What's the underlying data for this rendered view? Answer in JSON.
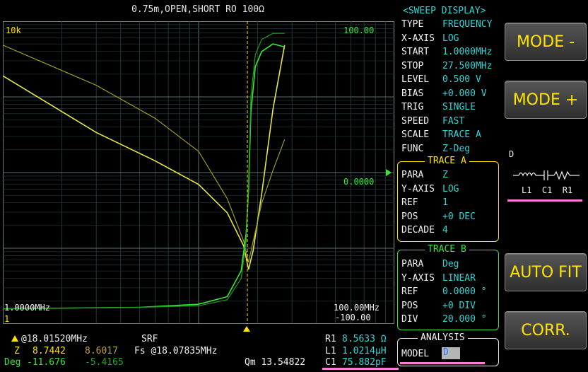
{
  "header": {
    "title": "0.75m,OPEN,SHORT  RO 100Ω"
  },
  "plot": {
    "y_top_left": "10k",
    "y_top_right": "100.00",
    "y_mid_right": "0.0000",
    "y_bottom_right": "-100.00",
    "x_left": "1.0000MHz",
    "x_right": "100.00MHz",
    "marker_id": "1"
  },
  "chart_data": {
    "type": "line",
    "xlabel": "",
    "ylabel": "",
    "x_scale": "log",
    "x_range_MHz": [
      1.0,
      100.0
    ],
    "yA_scale": "log",
    "yB_range_deg": [
      -100,
      100
    ],
    "grid": true,
    "marker_MHz": 18.0152,
    "series": [
      {
        "color": "#e6e64a",
        "axis": "A",
        "x_MHz": [
          1.0,
          3.0,
          6.0,
          10.0,
          14.0,
          17.0,
          18.0,
          19.0,
          21.0,
          24.0,
          27.5
        ],
        "z_rel": [
          0.82,
          0.58,
          0.46,
          0.36,
          0.24,
          0.1,
          0.0,
          0.08,
          0.32,
          0.68,
          0.95
        ]
      },
      {
        "color": "#9a9a2a",
        "axis": "A",
        "x_MHz": [
          1.0,
          3.0,
          6.0,
          10.0,
          14.0,
          17.0,
          18.0,
          19.0,
          21.0,
          24.0,
          27.5
        ],
        "z_rel": [
          0.95,
          0.78,
          0.64,
          0.5,
          0.3,
          0.12,
          0.03,
          0.12,
          0.28,
          0.42,
          0.55
        ]
      },
      {
        "color": "#39e639",
        "axis": "B",
        "x_MHz": [
          1.0,
          5.0,
          10.0,
          14.0,
          16.5,
          17.5,
          18.0,
          18.5,
          19.5,
          21.0,
          24.0,
          27.5
        ],
        "deg": [
          -90,
          -89,
          -87,
          -82,
          -65,
          -40,
          -11.7,
          40,
          70,
          80,
          85,
          83
        ]
      },
      {
        "color": "#1f9a1f",
        "axis": "B",
        "x_MHz": [
          1.0,
          5.0,
          10.0,
          14.0,
          16.5,
          17.5,
          18.0,
          18.5,
          19.5,
          21.0,
          24.0,
          27.5
        ],
        "deg": [
          -90,
          -89,
          -88,
          -84,
          -70,
          -45,
          -5.4,
          50,
          78,
          88,
          92,
          92
        ]
      }
    ]
  },
  "sweep": {
    "title": "<SWEEP DISPLAY>",
    "rows": [
      {
        "k": "TYPE",
        "v": "FREQUENCY"
      },
      {
        "k": "X-AXIS",
        "v": "LOG"
      },
      {
        "k": "START",
        "v": "1.0000MHz"
      },
      {
        "k": "STOP",
        "v": "27.500MHz"
      },
      {
        "k": "LEVEL",
        "v": "0.500 V"
      },
      {
        "k": "BIAS",
        "v": "+0.000 V"
      },
      {
        "k": "TRIG",
        "v": "SINGLE"
      },
      {
        "k": "SPEED",
        "v": "FAST"
      },
      {
        "k": "SCALE",
        "v": "TRACE A"
      },
      {
        "k": "FUNC",
        "v": "Z-Deg"
      }
    ]
  },
  "traceA": {
    "title": "TRACE A",
    "rows": [
      {
        "k": "PARA",
        "v": "Z"
      },
      {
        "k": "Y-AXIS",
        "v": "LOG"
      },
      {
        "k": "REF",
        "v": "1"
      },
      {
        "k": "POS",
        "v": "+0 DEC"
      },
      {
        "k": "DECADE",
        "v": "4"
      }
    ]
  },
  "traceB": {
    "title": "TRACE B",
    "rows": [
      {
        "k": "PARA",
        "v": "Deg"
      },
      {
        "k": "Y-AXIS",
        "v": "LINEAR"
      },
      {
        "k": "REF",
        "v": "0.0000 °"
      },
      {
        "k": "POS",
        "v": "+0 DIV"
      },
      {
        "k": "DIV",
        "v": "20.000 °"
      }
    ]
  },
  "analysis": {
    "title": "ANALYSIS",
    "model_label": "MODEL",
    "model_value": "D"
  },
  "buttons": {
    "mode_minus": "MODE -",
    "mode_plus": "MODE +",
    "auto_fit": "AUTO FIT",
    "corr": "CORR."
  },
  "model_diagram": {
    "title": "D",
    "labels": "L1  C1  R1"
  },
  "readout": {
    "marker_freq": "@18.01520MHz",
    "srf_label": "SRF",
    "fs_text": "Fs @18.07835MHz",
    "z_label": "Z",
    "z_a": "8.7442",
    "z_b": "8.6017",
    "deg_label": "Deg",
    "deg_a": "-11.676",
    "deg_b": "-5.4165",
    "qm_text": "Qm 13.54822",
    "r1_label": "R1",
    "r1_value": "8.5633 Ω",
    "l1_label": "L1",
    "l1_value": "1.0214µH",
    "c1_label": "C1",
    "c1_value": "75.882pF"
  },
  "colors": {
    "yellow": "#ffe400",
    "green": "#39e639",
    "cyan": "#2fd6d6",
    "pink": "#ff7bd8"
  }
}
